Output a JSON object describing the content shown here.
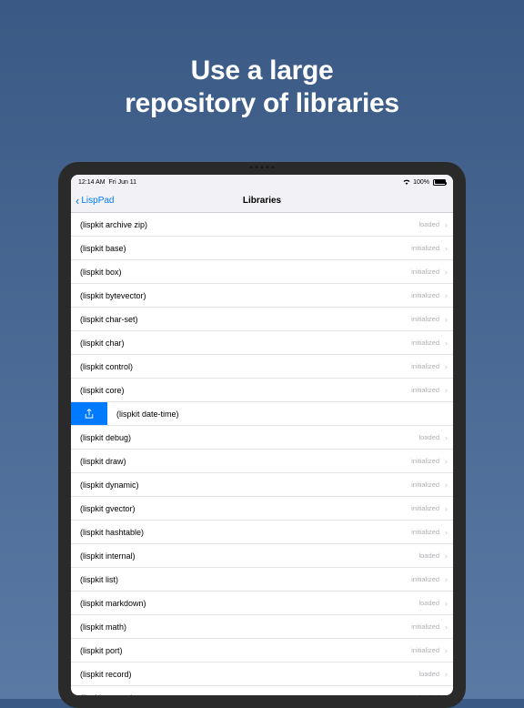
{
  "headline_line1": "Use a large",
  "headline_line2": "repository of libraries",
  "status": {
    "time": "12:14 AM",
    "date": "Fri Jun 11",
    "battery": "100%"
  },
  "nav": {
    "back": "LispPad",
    "title": "Libraries"
  },
  "libraries": [
    {
      "name": "(lispkit archive zip)",
      "status": "loaded",
      "swiped": false
    },
    {
      "name": "(lispkit base)",
      "status": "initialized",
      "swiped": false
    },
    {
      "name": "(lispkit box)",
      "status": "initialized",
      "swiped": false
    },
    {
      "name": "(lispkit bytevector)",
      "status": "initialized",
      "swiped": false
    },
    {
      "name": "(lispkit char-set)",
      "status": "initialized",
      "swiped": false
    },
    {
      "name": "(lispkit char)",
      "status": "initialized",
      "swiped": false
    },
    {
      "name": "(lispkit control)",
      "status": "initialized",
      "swiped": false
    },
    {
      "name": "(lispkit core)",
      "status": "initialized",
      "swiped": false
    },
    {
      "name": "(lispkit date-time)",
      "status": "",
      "swiped": true
    },
    {
      "name": "(lispkit debug)",
      "status": "loaded",
      "swiped": false
    },
    {
      "name": "(lispkit draw)",
      "status": "initialized",
      "swiped": false
    },
    {
      "name": "(lispkit dynamic)",
      "status": "initialized",
      "swiped": false
    },
    {
      "name": "(lispkit gvector)",
      "status": "initialized",
      "swiped": false
    },
    {
      "name": "(lispkit hashtable)",
      "status": "initialized",
      "swiped": false
    },
    {
      "name": "(lispkit internal)",
      "status": "loaded",
      "swiped": false
    },
    {
      "name": "(lispkit list)",
      "status": "initialized",
      "swiped": false
    },
    {
      "name": "(lispkit markdown)",
      "status": "loaded",
      "swiped": false
    },
    {
      "name": "(lispkit math)",
      "status": "initialized",
      "swiped": false
    },
    {
      "name": "(lispkit port)",
      "status": "initialized",
      "swiped": false
    },
    {
      "name": "(lispkit record)",
      "status": "loaded",
      "swiped": false
    },
    {
      "name": "(lispkit regexp)",
      "status": "loaded",
      "swiped": false
    }
  ]
}
